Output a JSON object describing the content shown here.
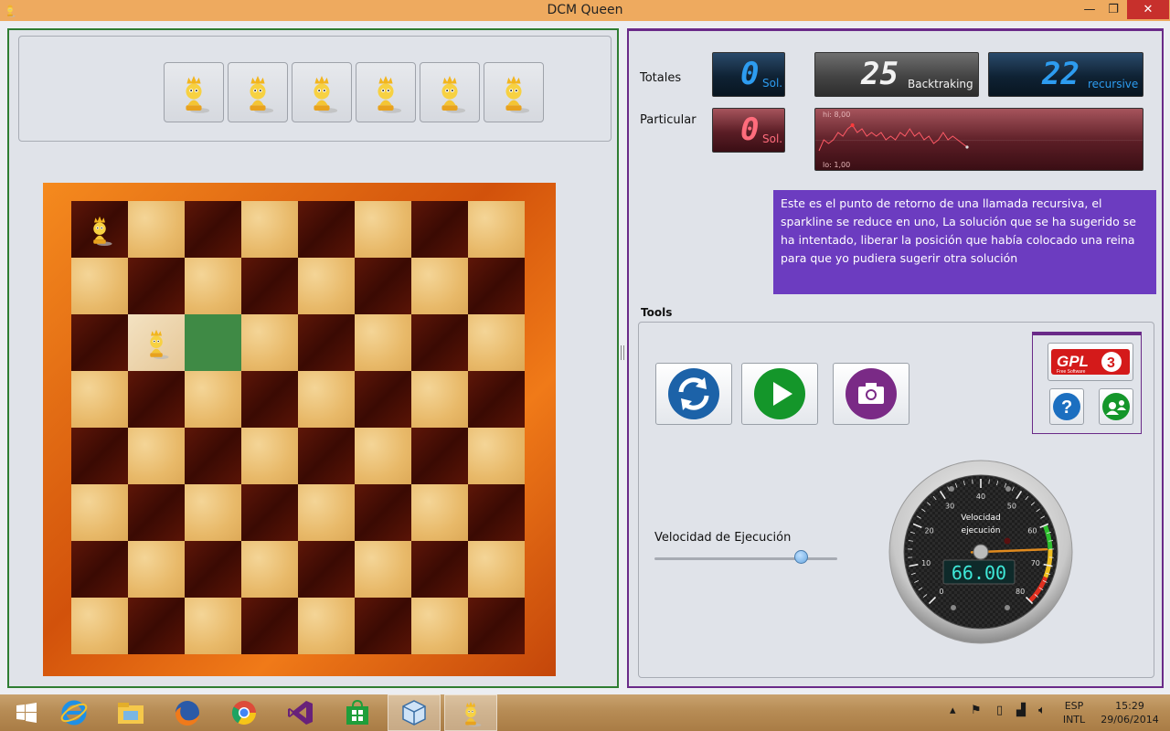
{
  "window": {
    "title": "DCM Queen",
    "min_glyph": "—",
    "max_glyph": "❐",
    "close_glyph": "✕"
  },
  "queens_tray": {
    "count": 6,
    "icon": "queen-icon"
  },
  "board": {
    "size": 8,
    "queens": [
      {
        "row": 1,
        "col": 1
      },
      {
        "row": 3,
        "col": 2
      }
    ],
    "highlight": {
      "row": 3,
      "col": 3
    },
    "queen_highlight_square": {
      "row": 3,
      "col": 2
    }
  },
  "stats": {
    "totals_label": "Totales",
    "particular_label": "Particular",
    "totals_solutions": {
      "value": "0",
      "unit": "Sol."
    },
    "backtracking": {
      "value": "25",
      "unit": "Backtraking"
    },
    "recursive": {
      "value": "22",
      "unit": "recursive"
    },
    "particular_solutions": {
      "value": "0",
      "unit": "Sol."
    }
  },
  "sparkline": {
    "hi_label": "hi: 8,00",
    "lo_label": "lo: 1,00",
    "values": [
      1,
      4,
      3,
      4,
      6,
      5,
      7,
      8,
      6,
      7,
      5,
      6,
      5,
      6,
      4,
      5,
      4,
      6,
      5,
      7,
      5,
      6,
      4,
      5,
      3,
      4,
      6,
      4,
      5,
      4,
      3,
      2
    ],
    "min": 1,
    "max": 8,
    "marker_color": "#ff3a3a"
  },
  "info": {
    "message": "Este es el punto de retorno de una llamada recursiva, el sparkline se reduce en uno, La solución que se ha sugerido se ha intentado, liberar la posición que había colocado una reina para que yo pudiera sugerir otra solución"
  },
  "tools": {
    "label": "Tools",
    "restart_icon": "refresh-icon",
    "play_icon": "play-icon",
    "capture_icon": "camera-icon",
    "gpl_label": "GPL",
    "gpl_sub": "Free Software",
    "help_label": "?",
    "about_icon": "user-share-icon"
  },
  "speed": {
    "label": "Velocidad de Ejecución",
    "slider_fraction": 0.8
  },
  "gauge": {
    "title_line1": "Velocidad",
    "title_line2": "ejecución",
    "value": "66.00",
    "ticks": [
      "0",
      "10",
      "20",
      "30",
      "40",
      "50",
      "60",
      "70",
      "80"
    ],
    "min": 0,
    "max": 80,
    "needle_value": 66
  },
  "taskbar": {
    "apps": [
      "windows-start-icon",
      "internet-explorer-icon",
      "file-explorer-icon",
      "firefox-icon",
      "chrome-icon",
      "visual-studio-icon",
      "store-icon",
      "virtualbox-icon",
      "dcm-queen-icon"
    ],
    "lang_line1": "ESP",
    "lang_line2": "INTL",
    "time": "15:29",
    "date": "29/06/2014"
  },
  "colors": {
    "accent_purple": "#6a2a88",
    "accent_green": "#2f7d32",
    "info_bg": "#6c3cc0"
  }
}
